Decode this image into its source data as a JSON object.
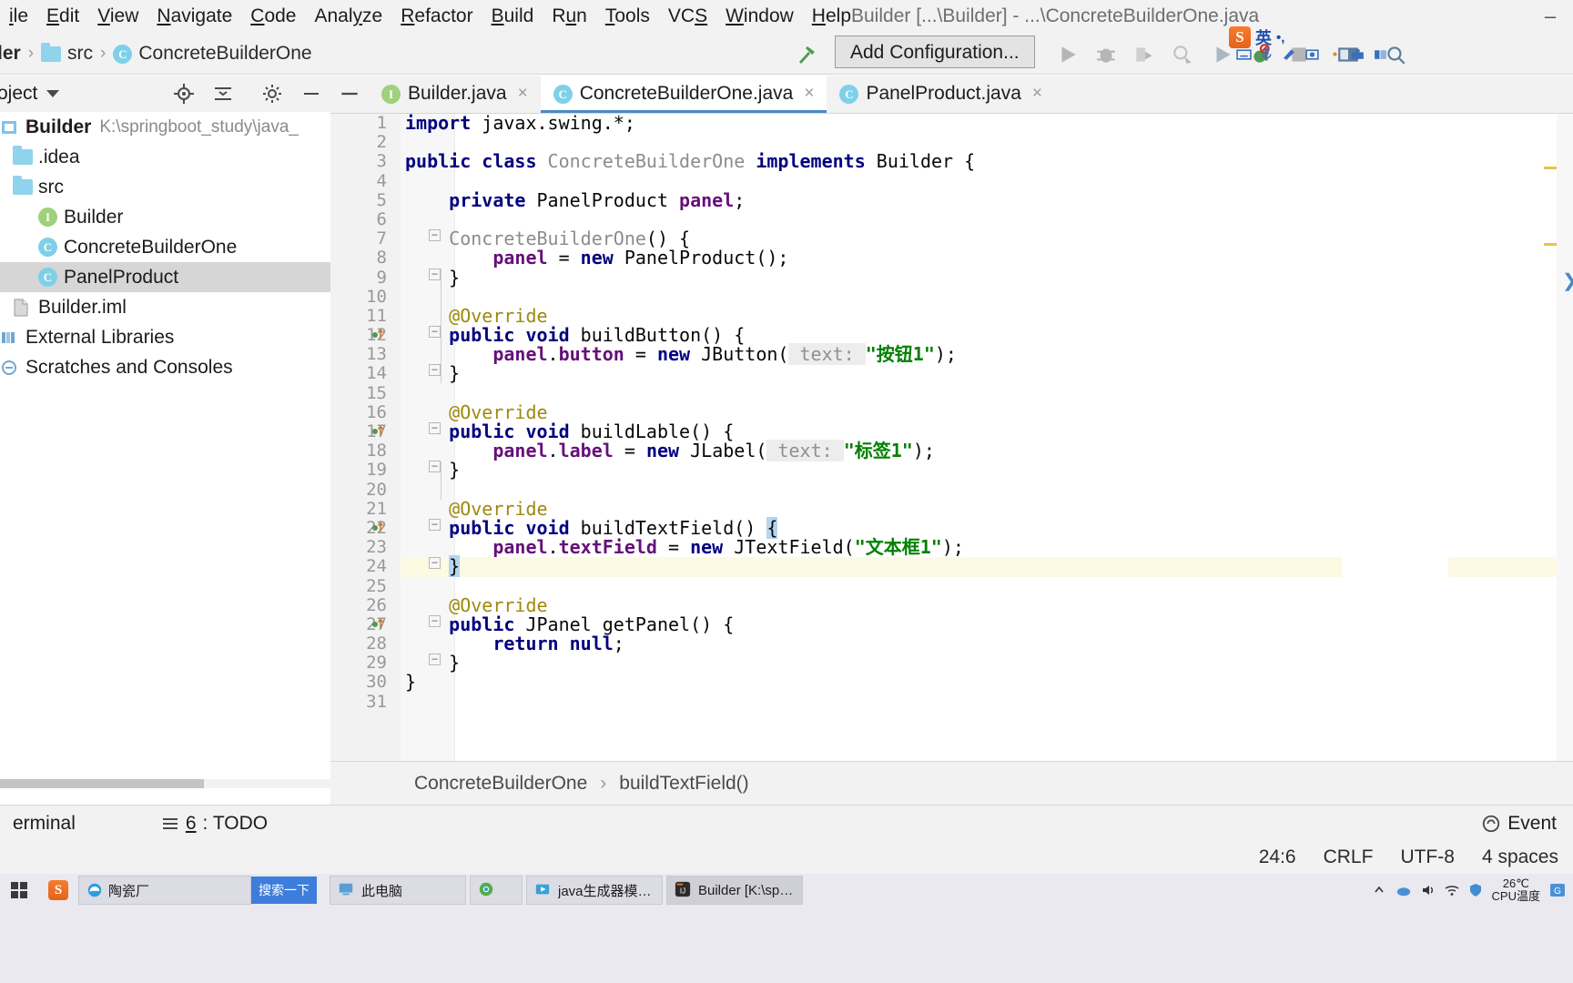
{
  "window": {
    "title": "Builder [...\\Builder] - ...\\ConcreteBuilderOne.java",
    "minimize_label": "–"
  },
  "menubar": {
    "items": [
      {
        "label": "ile",
        "name": "menu-file"
      },
      {
        "label": "Edit",
        "name": "menu-edit"
      },
      {
        "label": "View",
        "name": "menu-view"
      },
      {
        "label": "Navigate",
        "name": "menu-navigate"
      },
      {
        "label": "Code",
        "name": "menu-code"
      },
      {
        "label": "Analyze",
        "name": "menu-analyze"
      },
      {
        "label": "Refactor",
        "name": "menu-refactor"
      },
      {
        "label": "Build",
        "name": "menu-build"
      },
      {
        "label": "Run",
        "name": "menu-run"
      },
      {
        "label": "Tools",
        "name": "menu-tools"
      },
      {
        "label": "VCS",
        "name": "menu-vcs"
      },
      {
        "label": "Window",
        "name": "menu-window"
      },
      {
        "label": "Help",
        "name": "menu-help"
      }
    ]
  },
  "navbar": {
    "breadcrumb": [
      {
        "label": "der",
        "icon": "none"
      },
      {
        "label": "src",
        "icon": "folder-icon"
      },
      {
        "label": "ConcreteBuilderOne",
        "icon": "class-icon"
      }
    ],
    "separator": "›",
    "add_configuration_label": "Add Configuration...",
    "build_icon": "hammer-icon",
    "run_icon": "run-icon",
    "debug_icon": "debug-icon",
    "rerun_icon": "rerun-icon",
    "profile_icon": "profile-icon",
    "run_anything_icon": "run-anything-icon",
    "coverage_icon": "coverage-icon",
    "stop_icon": "stop-icon",
    "layout_icon": "layout-icon",
    "search_everywhere_icon": "search-everywhere-icon"
  },
  "project_panel": {
    "title": "roject",
    "title_caret": "chevron-down-icon",
    "toolbar_icons": [
      "locate-icon",
      "collapse-all-icon",
      "settings-gear-icon",
      "hide-icon"
    ],
    "tree": [
      {
        "label": "Builder",
        "sublabel": "K:\\springboot_study\\java_",
        "icon": "module-icon",
        "indent": 0,
        "bold": true,
        "selected": false
      },
      {
        "label": ".idea",
        "sublabel": "",
        "icon": "folder-icon",
        "indent": 1,
        "bold": false,
        "selected": false
      },
      {
        "label": "src",
        "sublabel": "",
        "icon": "folder-icon",
        "indent": 1,
        "bold": false,
        "selected": false
      },
      {
        "label": "Builder",
        "sublabel": "",
        "icon": "interface-icon",
        "indent": 2,
        "bold": false,
        "selected": false
      },
      {
        "label": "ConcreteBuilderOne",
        "sublabel": "",
        "icon": "class-icon",
        "indent": 2,
        "bold": false,
        "selected": false
      },
      {
        "label": "PanelProduct",
        "sublabel": "",
        "icon": "class-icon",
        "indent": 2,
        "bold": false,
        "selected": true
      },
      {
        "label": "Builder.iml",
        "sublabel": "",
        "icon": "iml-file-icon",
        "indent": 1,
        "bold": false,
        "selected": false
      },
      {
        "label": "External Libraries",
        "sublabel": "",
        "icon": "library-icon",
        "indent": 0,
        "bold": false,
        "selected": false
      },
      {
        "label": "Scratches and Consoles",
        "sublabel": "",
        "icon": "scratch-icon",
        "indent": 0,
        "bold": false,
        "selected": false
      }
    ]
  },
  "editor_tabs": [
    {
      "label": "Builder.java",
      "icon": "interface-icon",
      "active": false,
      "close": "×"
    },
    {
      "label": "ConcreteBuilderOne.java",
      "icon": "class-icon",
      "active": true,
      "close": "×"
    },
    {
      "label": "PanelProduct.java",
      "icon": "class-icon",
      "active": false,
      "close": "×"
    }
  ],
  "editor": {
    "current_line": 24,
    "lines": [
      {
        "n": 1,
        "fold": "",
        "gutter": "",
        "tokens": [
          {
            "t": "import ",
            "c": "kw"
          },
          {
            "t": "javax.swing.*;",
            "c": "plain"
          }
        ]
      },
      {
        "n": 2,
        "fold": "",
        "gutter": "",
        "tokens": []
      },
      {
        "n": 3,
        "fold": "",
        "gutter": "",
        "tokens": [
          {
            "t": "public class ",
            "c": "kw"
          },
          {
            "t": "ConcreteBuilderOne ",
            "c": "cls"
          },
          {
            "t": "implements ",
            "c": "kw"
          },
          {
            "t": "Builder {",
            "c": "plain"
          }
        ]
      },
      {
        "n": 4,
        "fold": "",
        "gutter": "",
        "tokens": []
      },
      {
        "n": 5,
        "fold": "",
        "gutter": "",
        "tokens": [
          {
            "t": "    private ",
            "c": "kw"
          },
          {
            "t": "PanelProduct ",
            "c": "plain"
          },
          {
            "t": "panel",
            "c": "fld"
          },
          {
            "t": ";",
            "c": "plain"
          }
        ]
      },
      {
        "n": 6,
        "fold": "",
        "gutter": "",
        "tokens": []
      },
      {
        "n": 7,
        "fold": "minus",
        "gutter": "",
        "tokens": [
          {
            "t": "    ",
            "c": "plain"
          },
          {
            "t": "ConcreteBuilderOne",
            "c": "cls"
          },
          {
            "t": "() {",
            "c": "plain"
          }
        ]
      },
      {
        "n": 8,
        "fold": "",
        "gutter": "",
        "tokens": [
          {
            "t": "        ",
            "c": "plain"
          },
          {
            "t": "panel",
            "c": "fld"
          },
          {
            "t": " = ",
            "c": "plain"
          },
          {
            "t": "new ",
            "c": "kw"
          },
          {
            "t": "PanelProduct();",
            "c": "plain"
          }
        ]
      },
      {
        "n": 9,
        "fold": "minus",
        "gutter": "",
        "tokens": [
          {
            "t": "    }",
            "c": "plain"
          }
        ]
      },
      {
        "n": 10,
        "fold": "",
        "gutter": "",
        "tokens": []
      },
      {
        "n": 11,
        "fold": "",
        "gutter": "",
        "tokens": [
          {
            "t": "    @Override",
            "c": "ann"
          }
        ]
      },
      {
        "n": 12,
        "fold": "minus",
        "gutter": "override",
        "tokens": [
          {
            "t": "    public void ",
            "c": "kw"
          },
          {
            "t": "buildButton() {",
            "c": "plain"
          }
        ]
      },
      {
        "n": 13,
        "fold": "",
        "gutter": "",
        "tokens": [
          {
            "t": "        ",
            "c": "plain"
          },
          {
            "t": "panel",
            "c": "fld"
          },
          {
            "t": ".",
            "c": "plain"
          },
          {
            "t": "button",
            "c": "fld"
          },
          {
            "t": " = ",
            "c": "plain"
          },
          {
            "t": "new ",
            "c": "kw"
          },
          {
            "t": "JButton(",
            "c": "plain"
          },
          {
            "t": " text: ",
            "c": "hint"
          },
          {
            "t": "\"按钮1\"",
            "c": "str"
          },
          {
            "t": ");",
            "c": "plain"
          }
        ]
      },
      {
        "n": 14,
        "fold": "minus",
        "gutter": "",
        "tokens": [
          {
            "t": "    }",
            "c": "plain"
          }
        ]
      },
      {
        "n": 15,
        "fold": "",
        "gutter": "",
        "tokens": []
      },
      {
        "n": 16,
        "fold": "",
        "gutter": "",
        "tokens": [
          {
            "t": "    @Override",
            "c": "ann"
          }
        ]
      },
      {
        "n": 17,
        "fold": "minus",
        "gutter": "override",
        "tokens": [
          {
            "t": "    public void ",
            "c": "kw"
          },
          {
            "t": "buildLable() {",
            "c": "plain"
          }
        ]
      },
      {
        "n": 18,
        "fold": "",
        "gutter": "",
        "tokens": [
          {
            "t": "        ",
            "c": "plain"
          },
          {
            "t": "panel",
            "c": "fld"
          },
          {
            "t": ".",
            "c": "plain"
          },
          {
            "t": "label",
            "c": "fld"
          },
          {
            "t": " = ",
            "c": "plain"
          },
          {
            "t": "new ",
            "c": "kw"
          },
          {
            "t": "JLabel(",
            "c": "plain"
          },
          {
            "t": " text: ",
            "c": "hint"
          },
          {
            "t": "\"标签1\"",
            "c": "str"
          },
          {
            "t": ");",
            "c": "plain"
          }
        ]
      },
      {
        "n": 19,
        "fold": "minus",
        "gutter": "",
        "tokens": [
          {
            "t": "    }",
            "c": "plain"
          }
        ]
      },
      {
        "n": 20,
        "fold": "",
        "gutter": "",
        "tokens": []
      },
      {
        "n": 21,
        "fold": "",
        "gutter": "",
        "tokens": [
          {
            "t": "    @Override",
            "c": "ann"
          }
        ]
      },
      {
        "n": 22,
        "fold": "minus",
        "gutter": "override",
        "tokens": [
          {
            "t": "    public void ",
            "c": "kw"
          },
          {
            "t": "buildTextField() ",
            "c": "plain"
          },
          {
            "t": "{",
            "c": "sel"
          }
        ]
      },
      {
        "n": 23,
        "fold": "",
        "gutter": "",
        "tokens": [
          {
            "t": "        ",
            "c": "plain"
          },
          {
            "t": "panel",
            "c": "fld"
          },
          {
            "t": ".",
            "c": "plain"
          },
          {
            "t": "textField",
            "c": "fld"
          },
          {
            "t": " = ",
            "c": "plain"
          },
          {
            "t": "new ",
            "c": "kw"
          },
          {
            "t": "JTextField(",
            "c": "plain"
          },
          {
            "t": "\"文本框1\"",
            "c": "str"
          },
          {
            "t": ");",
            "c": "plain"
          }
        ]
      },
      {
        "n": 24,
        "fold": "minus",
        "gutter": "",
        "tokens": [
          {
            "t": "    ",
            "c": "plain"
          },
          {
            "t": "}",
            "c": "sel"
          }
        ]
      },
      {
        "n": 25,
        "fold": "",
        "gutter": "",
        "tokens": []
      },
      {
        "n": 26,
        "fold": "",
        "gutter": "",
        "tokens": [
          {
            "t": "    @Override",
            "c": "ann"
          }
        ]
      },
      {
        "n": 27,
        "fold": "minus",
        "gutter": "override",
        "tokens": [
          {
            "t": "    public ",
            "c": "kw"
          },
          {
            "t": "JPanel ",
            "c": "plain"
          },
          {
            "t": "getPanel() {",
            "c": "plain"
          }
        ]
      },
      {
        "n": 28,
        "fold": "",
        "gutter": "",
        "tokens": [
          {
            "t": "        ",
            "c": "plain"
          },
          {
            "t": "return null",
            "c": "kw"
          },
          {
            "t": ";",
            "c": "plain"
          }
        ]
      },
      {
        "n": 29,
        "fold": "minus",
        "gutter": "",
        "tokens": [
          {
            "t": "    }",
            "c": "plain"
          }
        ]
      },
      {
        "n": 30,
        "fold": "",
        "gutter": "",
        "tokens": [
          {
            "t": "}",
            "c": "plain"
          }
        ]
      },
      {
        "n": 31,
        "fold": "",
        "gutter": "",
        "tokens": []
      }
    ]
  },
  "editor_breadcrumb": {
    "items": [
      "ConcreteBuilderOne",
      "buildTextField()"
    ],
    "separator": "›"
  },
  "bottom_strip": {
    "terminal_label": "erminal",
    "todo_number": "6",
    "todo_label": ": TODO",
    "todo_icon": "todo-list-icon",
    "event_log_label": "Event",
    "event_log_icon": "event-log-icon"
  },
  "statusbar": {
    "caret": "24:6",
    "line_separator": "CRLF",
    "encoding": "UTF-8",
    "indent": "4 spaces"
  },
  "ime": {
    "logo": "S",
    "mode": "英",
    "punct": "•,",
    "icons": [
      "keyboard-icon",
      "mic-icon",
      "handwriting-icon",
      "screenshot-icon",
      "dot-icon",
      "toolbox-icon",
      "skin-icon"
    ]
  },
  "taskbar": {
    "start_icon": "windows-start-icon",
    "sogou_icon": "sogou-icon",
    "browser_item": {
      "label": "陶瓷厂",
      "icon": "edge-icon"
    },
    "search_button": "搜索一下",
    "items": [
      {
        "label": "此电脑",
        "icon": "this-pc-icon",
        "active": false
      },
      {
        "label": "",
        "icon": "chrome-icon",
        "active": false
      },
      {
        "label": "java生成器模式 - ...",
        "icon": "video-icon",
        "active": false
      },
      {
        "label": "Builder [K:\\spring...",
        "icon": "intellij-icon",
        "active": true
      }
    ],
    "tray": {
      "temperature": "26℃",
      "temp_label": "CPU温度",
      "icons": [
        "tray-expand-icon",
        "cloud-icon",
        "volume-icon",
        "network-icon",
        "shield-icon",
        "translate-icon"
      ]
    }
  },
  "colors": {
    "accent": "#4a88c7",
    "keyword": "#000080",
    "string": "#008000",
    "field": "#660e7a",
    "annotation": "#9e880d",
    "selection": "#b4d5f0",
    "current_line": "#fcfae2",
    "chrome": "#f2f2f2"
  }
}
